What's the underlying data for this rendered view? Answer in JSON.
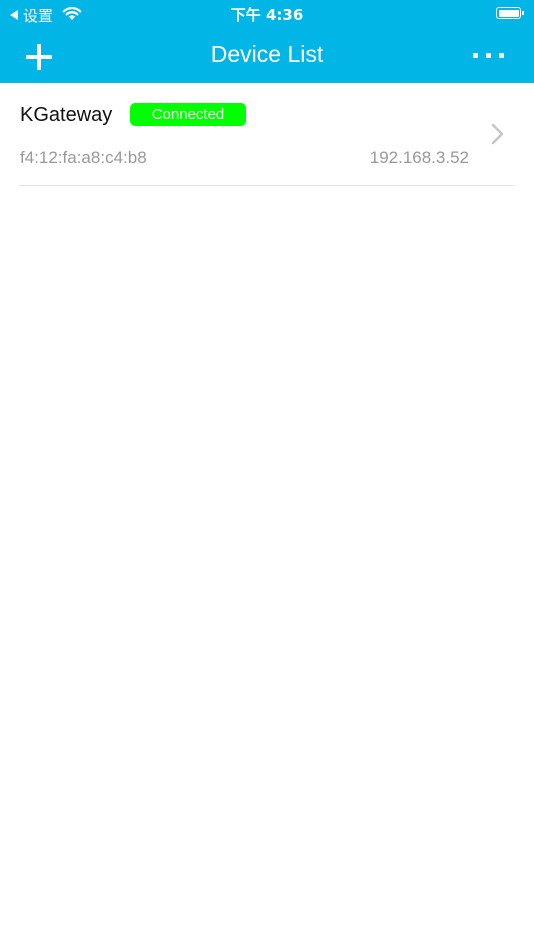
{
  "status_bar": {
    "back_app_label": "设置",
    "time": "下午 4:36",
    "battery_level": 1.0
  },
  "nav_bar": {
    "title": "Device List",
    "left_icon": "plus-icon",
    "right_icon": "more-dots-icon"
  },
  "devices": [
    {
      "name": "KGateway",
      "status": "Connected",
      "mac": "f4:12:fa:a8:c4:b8",
      "ip": "192.168.3.52"
    }
  ],
  "colors": {
    "header": "#01b6e6",
    "status_connected": "#00ff00",
    "secondary_text": "#999999",
    "divider": "#e5e5e5"
  }
}
